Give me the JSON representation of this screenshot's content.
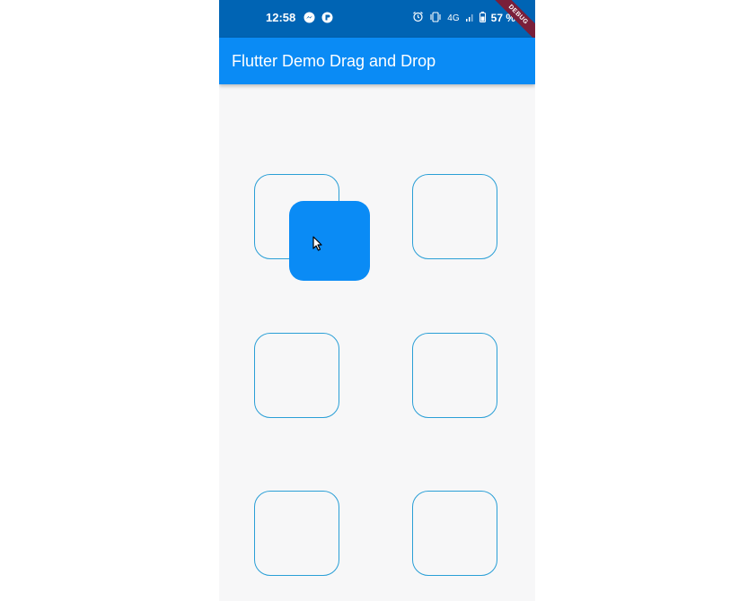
{
  "status_bar": {
    "time": "12:58",
    "network": "4G",
    "battery": "57 %",
    "left_icons": [
      "messenger-icon",
      "app-notification-icon"
    ],
    "right_icons": [
      "alarm-icon",
      "vibrate-icon",
      "signal-icon",
      "battery-icon"
    ]
  },
  "debug_banner": "DEBUG",
  "app_bar": {
    "title": "Flutter Demo Drag and Drop"
  },
  "grid": {
    "rows": 3,
    "columns": 2,
    "drop_targets": 6
  },
  "drag_state": {
    "dragging": true,
    "hover_target_index": 0
  },
  "colors": {
    "status_bar": "#0064b4",
    "app_bar": "#0a8bf5",
    "draggable": "#0a8bf5",
    "target_border": "#2a9fd6",
    "background": "#f7f7f8",
    "debug_banner": "#7a1f3a"
  }
}
